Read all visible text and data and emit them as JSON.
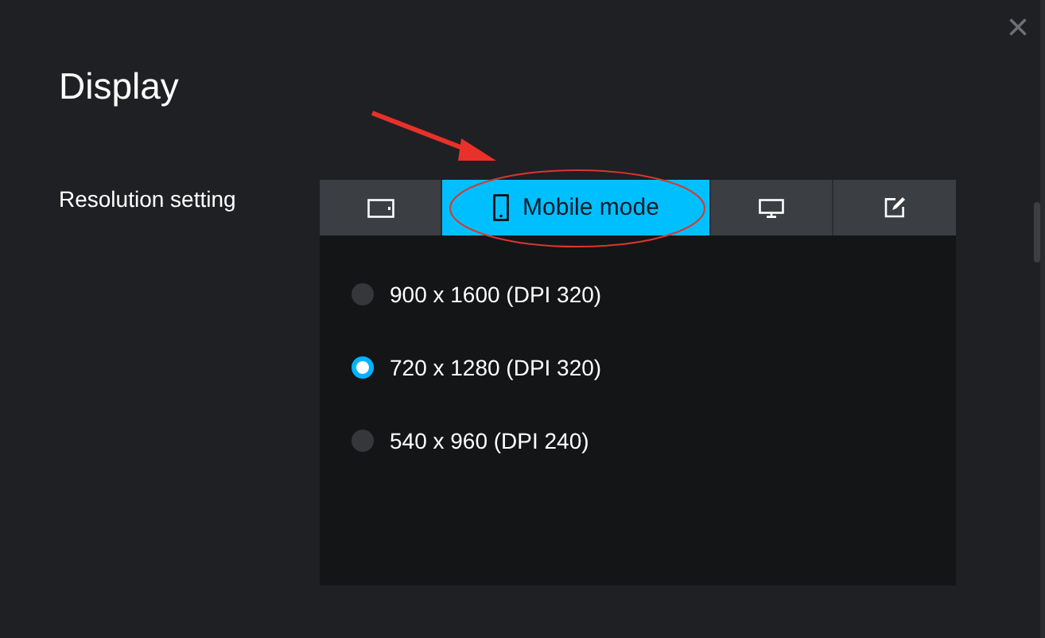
{
  "window": {
    "title": "Display",
    "close": "×"
  },
  "resolution": {
    "label": "Resolution setting",
    "tabs": [
      {
        "kind": "tablet",
        "selected": false
      },
      {
        "kind": "mobile",
        "label": "Mobile mode",
        "selected": true
      },
      {
        "kind": "desktop",
        "selected": false
      },
      {
        "kind": "custom",
        "selected": false
      }
    ],
    "options": [
      {
        "label": "900 x 1600 (DPI 320)",
        "selected": false
      },
      {
        "label": "720 x 1280 (DPI 320)",
        "selected": true
      },
      {
        "label": "540 x 960 (DPI 240)",
        "selected": false
      }
    ]
  }
}
